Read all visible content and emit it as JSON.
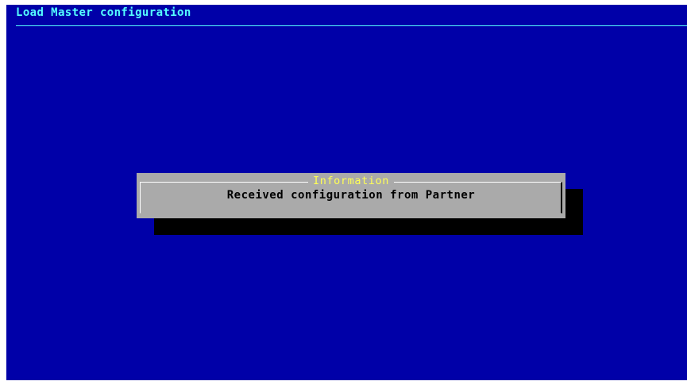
{
  "header": {
    "title": "Load Master configuration"
  },
  "dialog": {
    "title": "Information",
    "message": "Received configuration from Partner"
  },
  "colors": {
    "background": "#0000a8",
    "title_text": "#55ffff",
    "dialog_background": "#aaaaaa",
    "dialog_title": "#ffff55",
    "dialog_text": "#000000",
    "shadow": "#000000"
  }
}
